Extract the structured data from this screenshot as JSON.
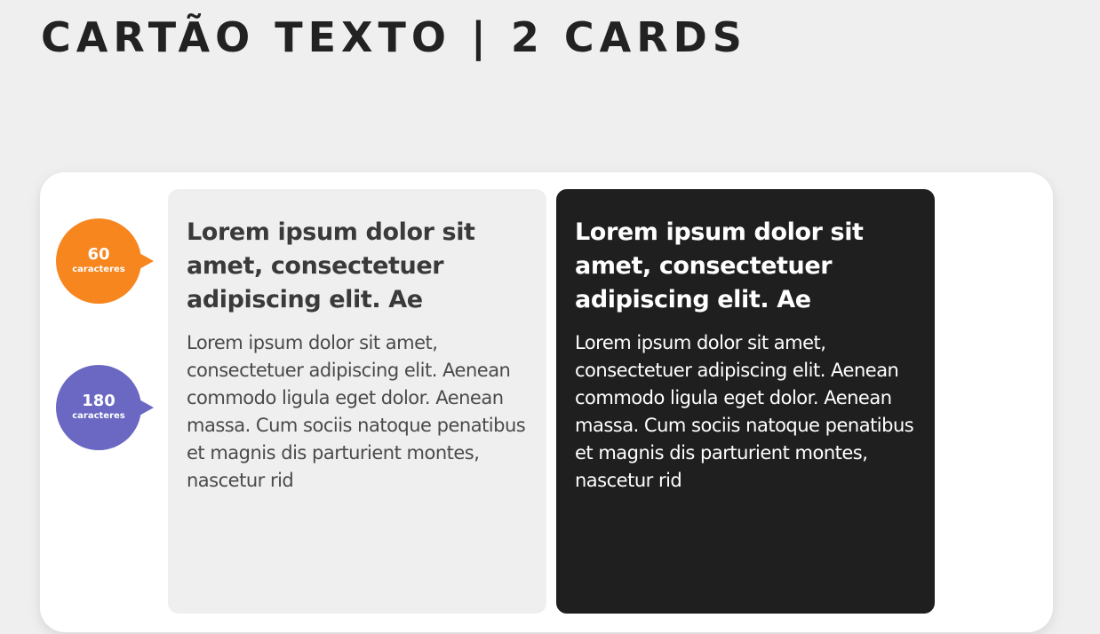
{
  "page": {
    "title": "CARTÃO TEXTO | 2 CARDS",
    "background": "#efefef"
  },
  "bubbles": {
    "title_limit": {
      "count": "60",
      "unit": "caracteres",
      "color": "#f7861f"
    },
    "body_limit": {
      "count": "180",
      "unit": "caracteres",
      "color": "#6a68c2"
    }
  },
  "cards": [
    {
      "theme": "light",
      "background": "#efefef",
      "title": "Lorem ipsum dolor sit amet, consectetuer adipiscing elit. Ae",
      "body": "Lorem ipsum dolor sit amet, consectetuer adipiscing elit. Aenean commodo ligula eget dolor. Aenean massa. Cum sociis natoque penatibus et magnis dis parturient montes, nascetur rid"
    },
    {
      "theme": "dark",
      "background": "#1f1f1f",
      "title": "Lorem ipsum dolor sit amet, consectetuer adipiscing elit. Ae",
      "body": "Lorem ipsum dolor sit amet, consectetuer adipiscing elit. Aenean commodo ligula eget dolor. Aenean massa. Cum sociis natoque penatibus et magnis dis parturient montes, nascetur rid"
    }
  ]
}
